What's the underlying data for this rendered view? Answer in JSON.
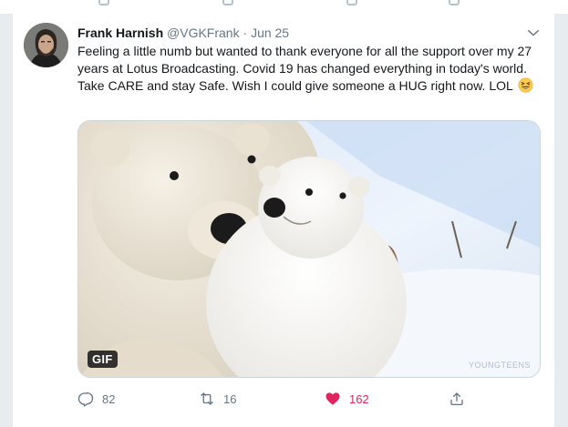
{
  "tweet": {
    "author_name": "Frank Harnish",
    "handle": "@VGKFrank",
    "separator": "·",
    "date": "Jun 25",
    "text": "Feeling a little numb but wanted to thank everyone for all the support over my 27 years at Lotus Broadcasting. Covid 19 has changed everything in today's world. Take CARE and stay Safe. Wish I could give someone a HUG right now. LOL",
    "emoji": "grinning-squinting-face-icon",
    "media": {
      "badge": "GIF",
      "watermark": "YOUNGTEENS"
    },
    "actions": {
      "replies": "82",
      "retweets": "16",
      "likes": "162",
      "liked": true
    }
  },
  "colors": {
    "accent_like": "#e0245e",
    "muted_text": "#657786",
    "border": "#e6ecf0"
  }
}
